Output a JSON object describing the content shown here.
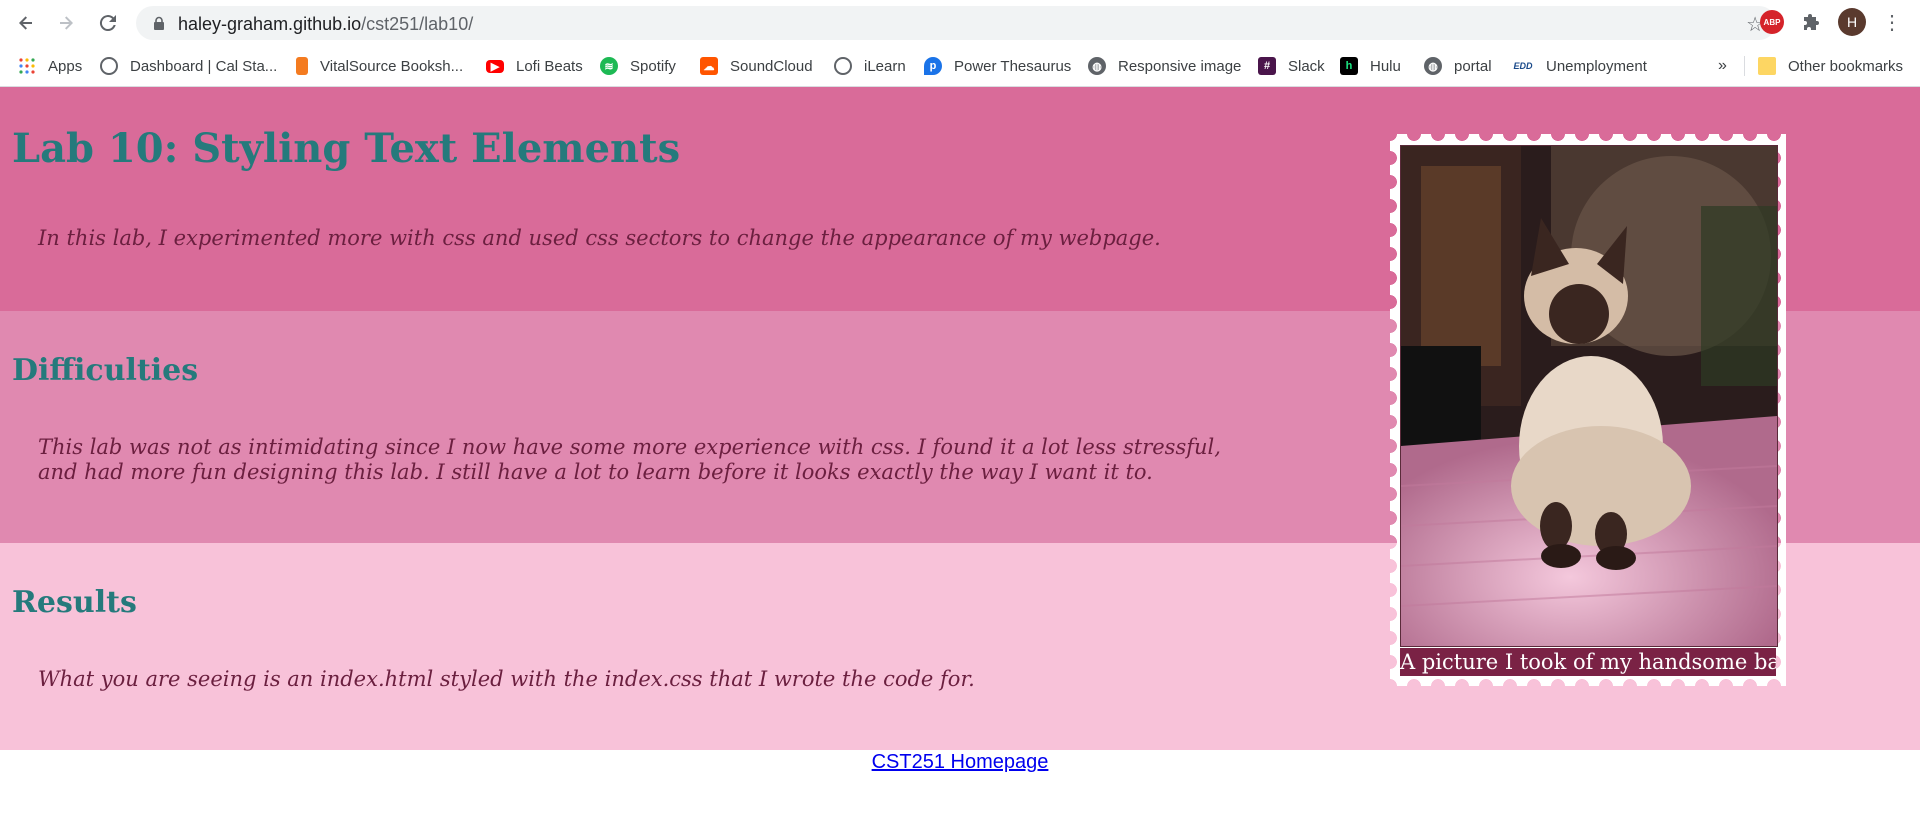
{
  "browser": {
    "url_host": "haley-graham.github.io",
    "url_path": "/cst251/lab10/",
    "avatar_letter": "H",
    "abp_label": "ABP"
  },
  "bookmarks": [
    {
      "label": "Apps",
      "icon": "apps-grid-icon",
      "color": "#ea4335"
    },
    {
      "label": "Dashboard | Cal Sta...",
      "icon": "canvas-icon",
      "color": "#5f6368"
    },
    {
      "label": "VitalSource Booksh...",
      "icon": "vitalsource-icon",
      "color": "#f47b20"
    },
    {
      "label": "Lofi Beats",
      "icon": "youtube-icon",
      "color": "#ff0000"
    },
    {
      "label": "Spotify",
      "icon": "spotify-icon",
      "color": "#1db954"
    },
    {
      "label": "SoundCloud",
      "icon": "soundcloud-icon",
      "color": "#ff5500"
    },
    {
      "label": "iLearn",
      "icon": "ilearn-icon",
      "color": "#5f6368"
    },
    {
      "label": "Power Thesaurus",
      "icon": "power-thesaurus-icon",
      "color": "#1a73e8"
    },
    {
      "label": "Responsive image",
      "icon": "globe-icon",
      "color": "#5f6368"
    },
    {
      "label": "Slack",
      "icon": "slack-icon",
      "color": "#4a154b"
    },
    {
      "label": "Hulu",
      "icon": "hulu-icon",
      "color": "#000000"
    },
    {
      "label": "portal",
      "icon": "globe-icon",
      "color": "#5f6368"
    },
    {
      "label": "Unemployment",
      "icon": "edd-icon",
      "color": "#1a4a8a"
    }
  ],
  "bookmarks_overflow": "»",
  "other_bookmarks": "Other bookmarks",
  "page": {
    "title": "Lab 10: Styling Text Elements",
    "intro": "In this lab, I experimented more with css and used css sectors to change the appearance of my webpage.",
    "difficulties_heading": "Difficulties",
    "difficulties_line1": "This lab was not as intimidating since I now have some more experience with css. I found it a lot less stressful,",
    "difficulties_line2": "and had more fun designing this lab. I still have a lot to learn before it looks exactly the way I want it to.",
    "results_heading": "Results",
    "results_text": "What you are seeing is an index.html styled with the index.css that I wrote the code for.",
    "photo_caption": "A picture I took of my handsome baby",
    "footer_link": "CST251 Homepage"
  },
  "colors": {
    "section1": "#d96b99",
    "section2": "#e089b0",
    "section3": "#f8c2d9",
    "heading": "#257a7c",
    "body_text": "#6b1f3f"
  }
}
